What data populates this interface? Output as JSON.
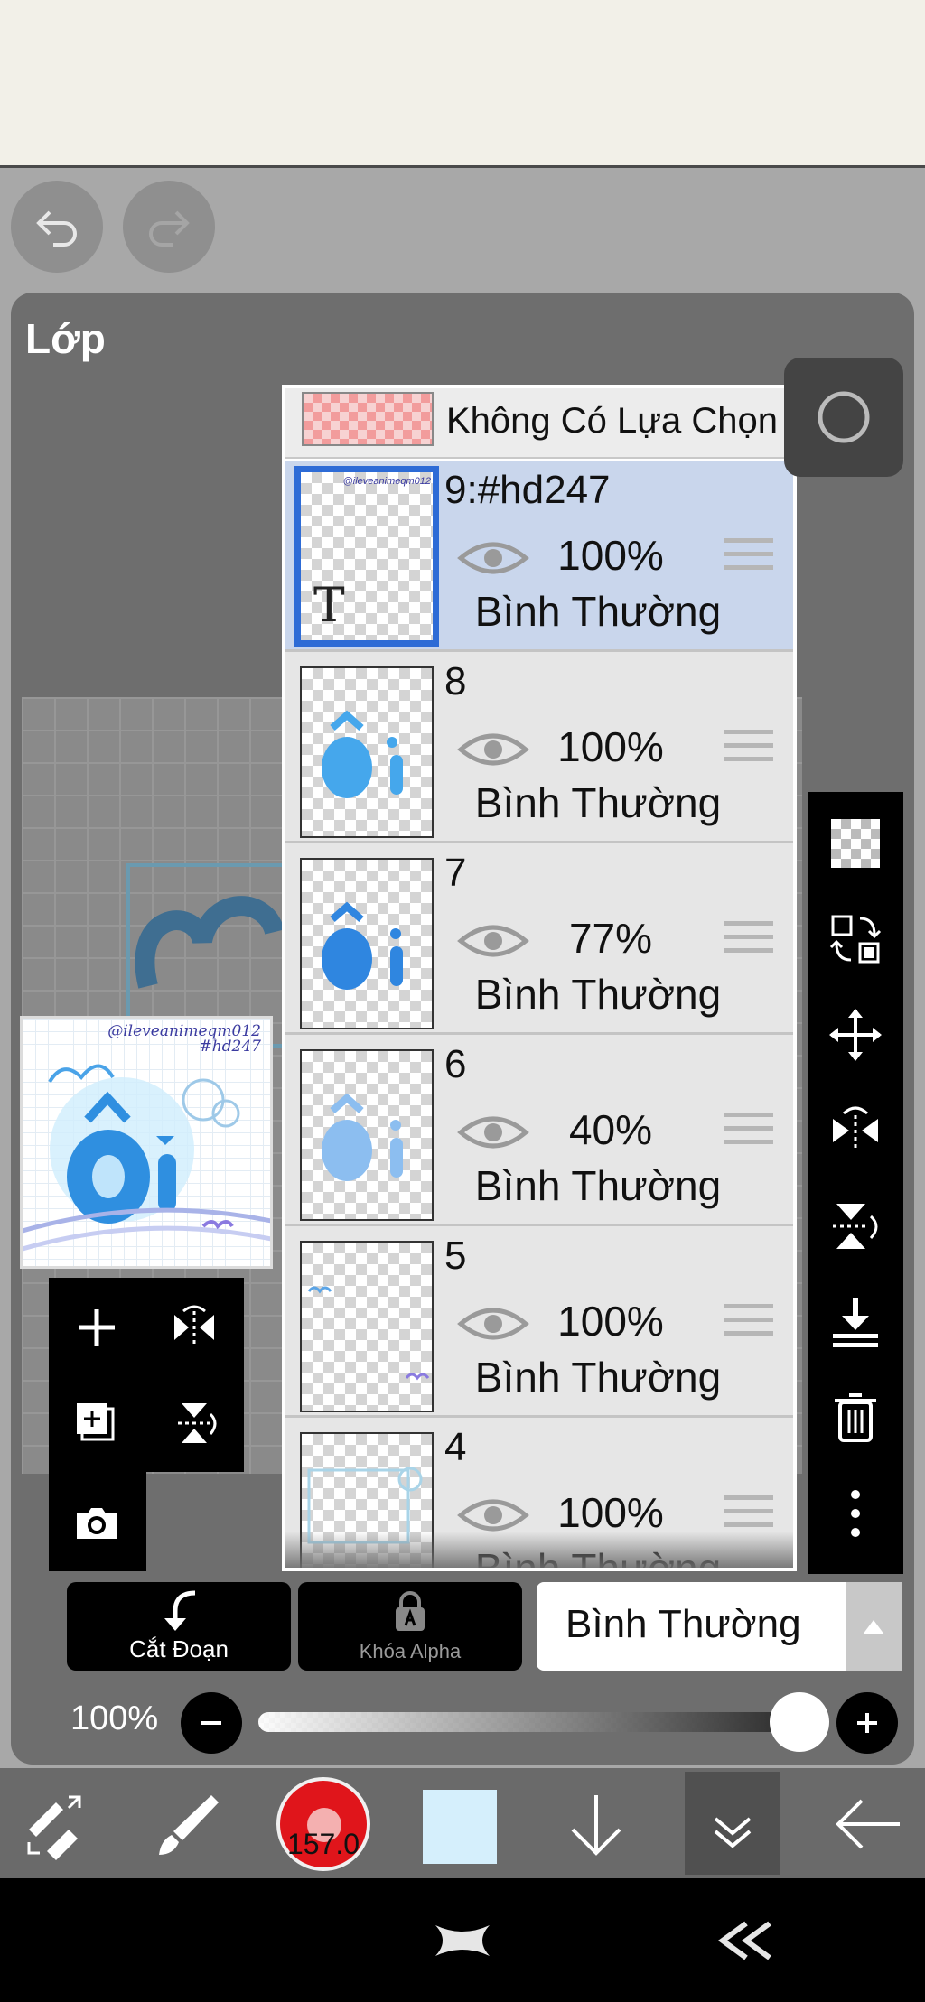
{
  "panel": {
    "title": "Lớp"
  },
  "layers": {
    "no_selection_label": "Không Có Lựa Chọn",
    "items": [
      {
        "name": "9:#hd247",
        "opacity": "100%",
        "blend": "Bình Thường",
        "selected": true
      },
      {
        "name": "8",
        "opacity": "100%",
        "blend": "Bình Thường",
        "selected": false
      },
      {
        "name": "7",
        "opacity": "77%",
        "blend": "Bình Thường",
        "selected": false
      },
      {
        "name": "6",
        "opacity": "40%",
        "blend": "Bình Thường",
        "selected": false
      },
      {
        "name": "5",
        "opacity": "100%",
        "blend": "Bình Thường",
        "selected": false
      },
      {
        "name": "4",
        "opacity": "100%",
        "blend": "Bình Thường",
        "selected": false
      }
    ],
    "text_layer_glyph": "T"
  },
  "preview": {
    "watermark_line1": "@ileveanimeqm012",
    "watermark_line2": "#hd247"
  },
  "actions": {
    "clipping_label": "Cắt Đoạn",
    "alpha_lock_label": "Khóa Alpha",
    "blend_mode_value": "Bình Thường"
  },
  "opacity": {
    "value_label": "100%",
    "value": 1.0
  },
  "brush": {
    "size_label": "157.0",
    "color": "#e0151b"
  },
  "current_color": "#d5effc",
  "colors": {
    "selection_blue": "#2d6bd6",
    "selected_row": "#c9d6ec"
  }
}
